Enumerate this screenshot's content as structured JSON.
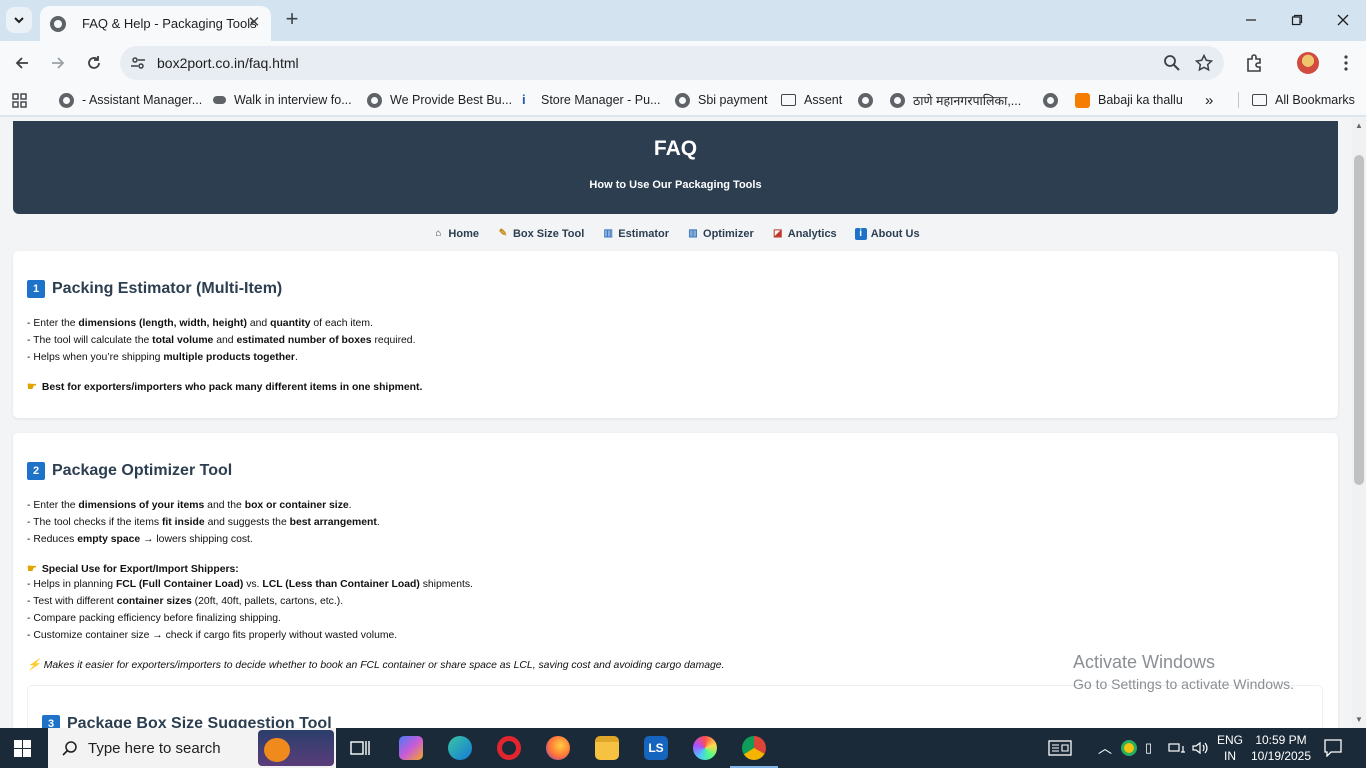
{
  "browser": {
    "tab_title": "FAQ & Help - Packaging Tools",
    "url": "box2port.co.in/faq.html",
    "bookmarks": [
      {
        "label": "- Assistant Manager...",
        "icon": "globe-icon"
      },
      {
        "label": "Walk in interview fo...",
        "icon": "site-icon"
      },
      {
        "label": "We Provide Best Bu...",
        "icon": "globe-icon"
      },
      {
        "label": "Store Manager - Pu...",
        "icon": "indeed-icon"
      },
      {
        "label": "Sbi payment",
        "icon": "globe-icon"
      },
      {
        "label": "Assent",
        "icon": "folder-icon"
      },
      {
        "label": "ठाणे महानगरपालिका,...",
        "icon": "globe-icon"
      },
      {
        "label": "Babaji ka thallu",
        "icon": "blogger-icon"
      },
      {
        "label": "All Bookmarks",
        "icon": "folder-icon"
      }
    ]
  },
  "page": {
    "hero_title": "FAQ",
    "hero_subtitle": "How to Use Our Packaging Tools",
    "nav": [
      {
        "label": "Home",
        "icon": "house-icon"
      },
      {
        "label": "Box Size Tool",
        "icon": "ruler-icon"
      },
      {
        "label": "Estimator",
        "icon": "bar-chart-icon"
      },
      {
        "label": "Optimizer",
        "icon": "bar-chart-icon"
      },
      {
        "label": "Analytics",
        "icon": "line-chart-icon"
      },
      {
        "label": "About Us",
        "icon": "info-icon"
      }
    ],
    "sections": [
      {
        "number": "1",
        "title": "Packing Estimator (Multi-Item)",
        "lines": [
          "- Enter the <b>dimensions (length, width, height)</b> and <b>quantity</b> of each item.",
          "- The tool will calculate the <b>total volume</b> and <b>estimated number of boxes</b> required.",
          "- Helps when you’re shipping <b>multiple products together</b>."
        ],
        "tip": "Best for exporters/importers who pack many different items in one shipment."
      },
      {
        "number": "2",
        "title": "Package Optimizer Tool",
        "lines": [
          "- Enter the <b>dimensions of your items</b> and the <b>box or container size</b>.",
          "- The tool checks if the items <b>fit inside</b> and suggests the <b>best arrangement</b>.",
          "- Reduces <b>empty space</b> → lowers shipping cost."
        ],
        "special_heading": "Special Use for Export/Import Shippers:",
        "special_lines": [
          "- Helps in planning <b>FCL (Full Container Load)</b> vs. <b>LCL (Less than Container Load)</b> shipments.",
          "- Test with different <b>container sizes</b> (20ft, 40ft, pallets, cartons, etc.).",
          "- Compare packing efficiency before finalizing shipping.",
          "- Customize container size → check if cargo fits properly without wasted volume."
        ],
        "note": "Makes it easier for exporters/importers to decide whether to book an FCL container or share space as LCL, saving cost and avoiding cargo damage."
      },
      {
        "number": "3",
        "title": "Package Box Size Suggestion Tool"
      }
    ]
  },
  "watermark": {
    "title": "Activate Windows",
    "subtitle": "Go to Settings to activate Windows."
  },
  "taskbar": {
    "search_placeholder": "Type here to search",
    "lang": "ENG",
    "region": "IN",
    "time": "10:59 PM",
    "date": "10/19/2025"
  }
}
